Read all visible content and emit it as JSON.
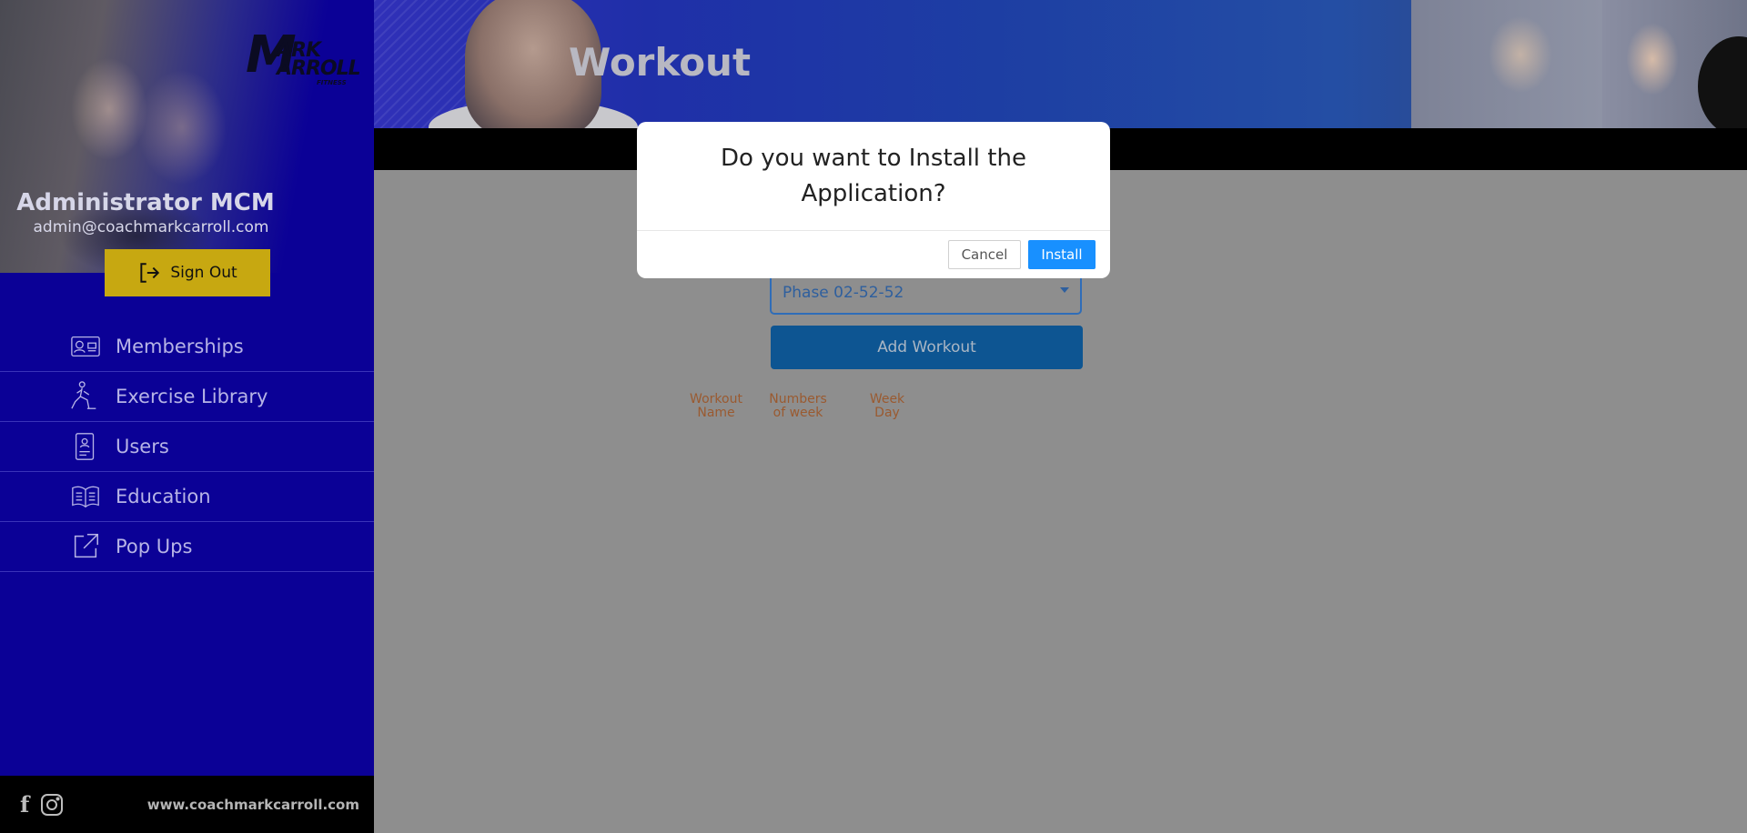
{
  "sidebar": {
    "logo": {
      "m": "M",
      "line1": "ARK",
      "line2": "ARROLL",
      "line3": "FITNESS"
    },
    "admin_name": "Administrator MCM",
    "admin_email": "admin@coachmarkcarroll.com",
    "sign_out_label": "Sign Out",
    "items": [
      {
        "label": "Memberships",
        "icon": "id-card-icon"
      },
      {
        "label": "Exercise Library",
        "icon": "exercise-person-icon"
      },
      {
        "label": "Users",
        "icon": "user-badge-icon"
      },
      {
        "label": "Education",
        "icon": "open-book-icon"
      },
      {
        "label": "Pop Ups",
        "icon": "external-link-icon"
      }
    ],
    "footer_site": "www.coachmarkcarroll.com",
    "social": [
      "facebook-icon",
      "instagram-icon"
    ]
  },
  "header": {
    "title": "Workout"
  },
  "main": {
    "phase_selected": "Phase 02-52-52",
    "add_workout_label": "Add Workout",
    "columns": [
      "Workout\nName",
      "Numbers\nof week",
      "Week\nDay"
    ]
  },
  "modal": {
    "question": "Do you want to Install the Application?",
    "cancel_label": "Cancel",
    "install_label": "Install"
  },
  "colors": {
    "sidebar_bg": "#0b0196",
    "signout_bg": "#c7a811",
    "install_button": "#1890ff",
    "add_workout_button": "#0d5592"
  }
}
